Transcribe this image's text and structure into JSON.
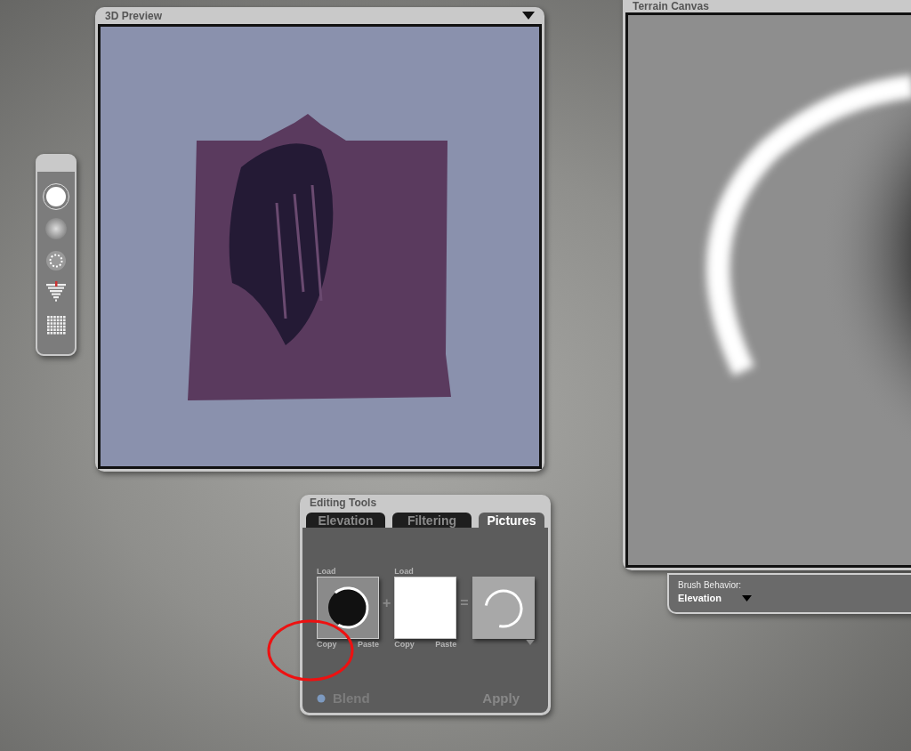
{
  "preview_window": {
    "title": "3D Preview"
  },
  "tool_palette": {
    "tools": [
      {
        "kind": "hard-brush",
        "selected": true
      },
      {
        "kind": "soft-brush",
        "selected": false
      },
      {
        "kind": "ring-brush",
        "selected": false
      },
      {
        "kind": "levels",
        "selected": false
      },
      {
        "kind": "grid",
        "selected": false
      }
    ]
  },
  "terrain_canvas": {
    "title": "Terrain Canvas"
  },
  "brush_behavior": {
    "label": "Brush Behavior:",
    "value": "Elevation"
  },
  "editing_tools": {
    "title": "Editing Tools",
    "tabs": [
      {
        "label": "Elevation",
        "selected": false
      },
      {
        "label": "Filtering",
        "selected": false
      },
      {
        "label": "Pictures",
        "selected": true
      }
    ],
    "pictures": [
      {
        "kind": "ring",
        "load": "Load",
        "copy": "Copy",
        "paste": "Paste"
      },
      {
        "kind": "blank",
        "load": "Load",
        "copy": "Copy",
        "paste": "Paste"
      }
    ],
    "plus": "+",
    "equals": "=",
    "blend": "Blend",
    "apply": "Apply"
  }
}
